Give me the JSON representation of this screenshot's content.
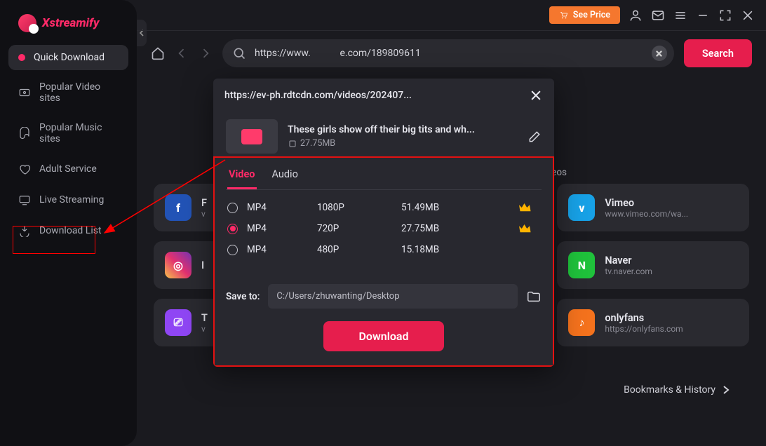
{
  "brand": "Xstreamify",
  "sidebar": {
    "items": [
      {
        "label": "Quick Download"
      },
      {
        "label": "Popular Video sites"
      },
      {
        "label": "Popular Music sites"
      },
      {
        "label": "Adult Service"
      },
      {
        "label": "Live Streaming"
      },
      {
        "label": "Download List"
      }
    ]
  },
  "titlebar": {
    "see_price": "See Price"
  },
  "toolbar": {
    "url": "https://www.            e.com/189809611",
    "search_label": "Search"
  },
  "category_label": "videos",
  "sites": [
    {
      "name": "F",
      "url": "v"
    },
    {
      "name": "Vimeo",
      "url": "www.vimeo.com/wa..."
    },
    {
      "name": "I",
      "url": ""
    },
    {
      "name": "Naver",
      "url": "tv.naver.com"
    },
    {
      "name": "T",
      "url": "v"
    },
    {
      "name": "onlyfans",
      "url": "https://onlyfans.com"
    }
  ],
  "bookmarks_label": "Bookmarks & History",
  "dialog": {
    "header": "https://ev-ph.rdtcdn.com/videos/202407...",
    "media_title": "These girls show off their big tits and wh...",
    "media_size": "27.75MB",
    "tabs": {
      "video": "Video",
      "audio": "Audio"
    },
    "formats": [
      {
        "codec": "MP4",
        "res": "1080P",
        "size": "51.49MB",
        "premium": true,
        "selected": false
      },
      {
        "codec": "MP4",
        "res": "720P",
        "size": "27.75MB",
        "premium": true,
        "selected": true
      },
      {
        "codec": "MP4",
        "res": "480P",
        "size": "15.18MB",
        "premium": false,
        "selected": false
      }
    ],
    "save_label": "Save to:",
    "save_path": "C:/Users/zhuwanting/Desktop",
    "download_label": "Download"
  }
}
